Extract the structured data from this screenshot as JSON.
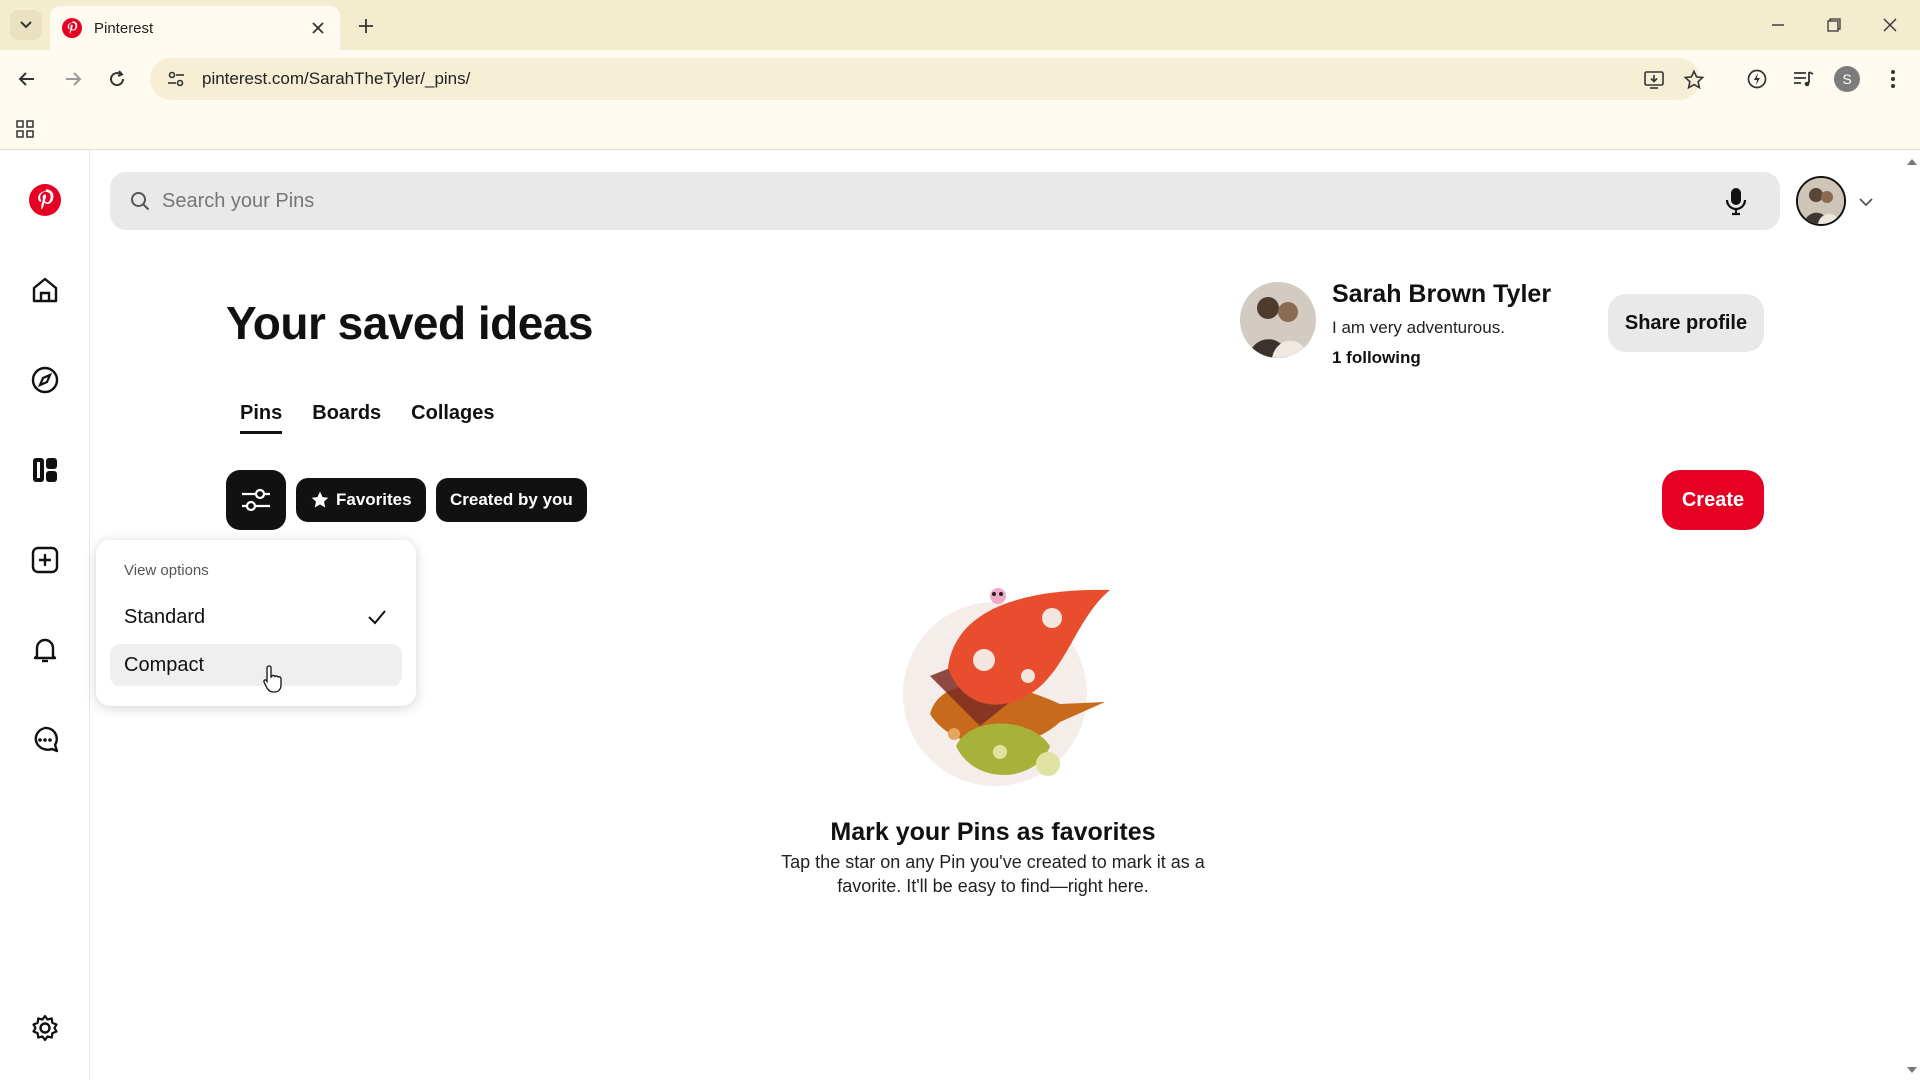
{
  "browser": {
    "tab_title": "Pinterest",
    "url": "pinterest.com/SarahTheTyler/_pins/",
    "profile_initial": "S"
  },
  "search": {
    "placeholder": "Search your Pins"
  },
  "header": {
    "title": "Your saved ideas"
  },
  "profile": {
    "name": "Sarah Brown Tyler",
    "bio": "I am very adventurous.",
    "following": "1 following",
    "share_label": "Share profile"
  },
  "tabs": [
    {
      "label": "Pins",
      "active": true
    },
    {
      "label": "Boards",
      "active": false
    },
    {
      "label": "Collages",
      "active": false
    }
  ],
  "filters": {
    "favorites_label": "Favorites",
    "created_label": "Created by you",
    "create_label": "Create"
  },
  "view_options": {
    "heading": "View options",
    "items": [
      {
        "label": "Standard",
        "selected": true
      },
      {
        "label": "Compact",
        "selected": false
      }
    ]
  },
  "empty_state": {
    "title": "Mark your Pins as favorites",
    "text": "Tap the star on any Pin you've created to mark it as a favorite. It'll be easy to find—right here."
  },
  "colors": {
    "brand_red": "#e60023",
    "chip_dark": "#111111",
    "chrome_bg": "#f3eccf"
  },
  "icons": {
    "sidebar": [
      "pinterest-logo-icon",
      "home-icon",
      "explore-icon",
      "dashboard-icon",
      "create-icon",
      "notifications-icon",
      "messages-icon",
      "settings-icon"
    ]
  }
}
